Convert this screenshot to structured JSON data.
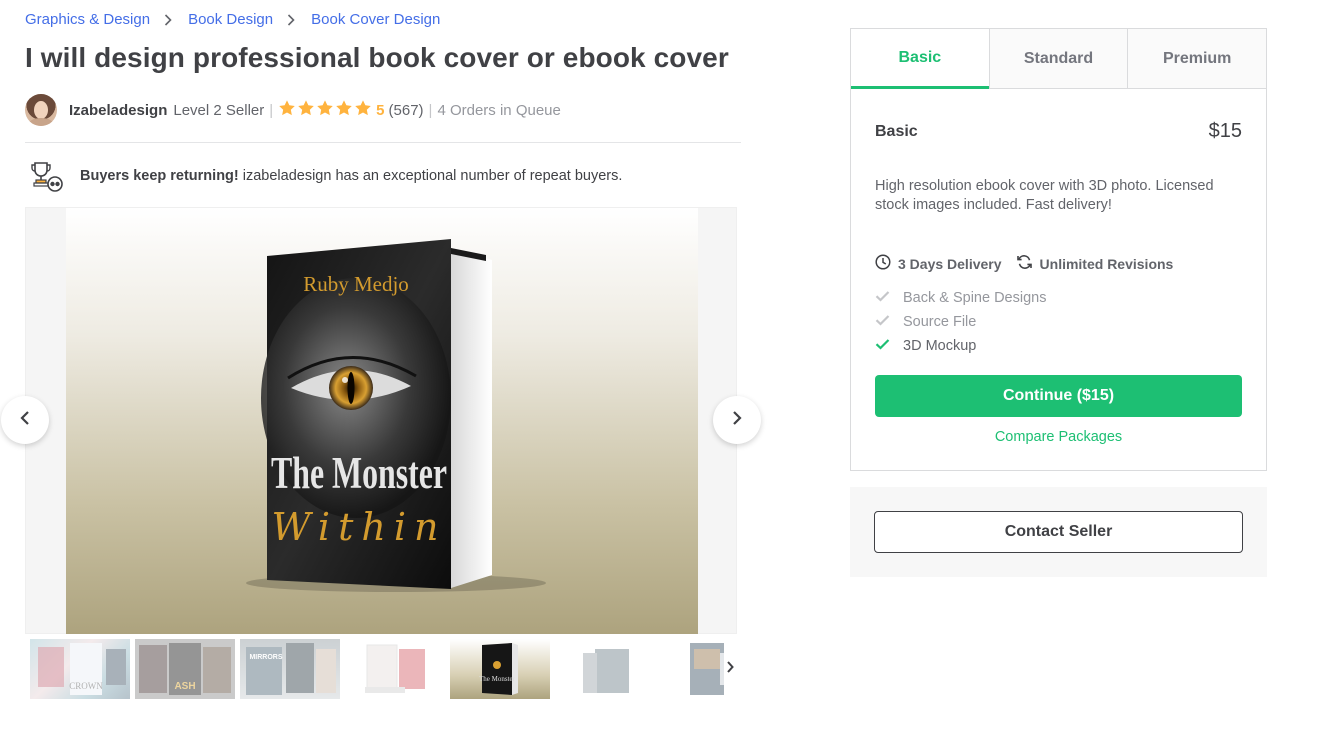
{
  "breadcrumb": {
    "items": [
      "Graphics & Design",
      "Book Design",
      "Book Cover Design"
    ]
  },
  "gig": {
    "title": "I will design professional book cover or ebook cover"
  },
  "seller": {
    "name": "Izabeladesign",
    "level": "Level 2 Seller",
    "rating_value": "5",
    "rating_stars": 5,
    "review_count": "(567)",
    "orders_in_queue": "4 Orders in Queue"
  },
  "repeat_buyers": {
    "headline": "Buyers keep returning!",
    "text": "izabeladesign has an exceptional number of repeat buyers.",
    "icon": "trophy-icon"
  },
  "gallery": {
    "book_author": "Ruby Medjo",
    "book_title_line1": "The Monster",
    "book_title_line2": "Within",
    "active_thumbnail": 5,
    "thumbnail_count": 7
  },
  "packages": {
    "tabs": [
      "Basic",
      "Standard",
      "Premium"
    ],
    "active_tab": "Basic",
    "name": "Basic",
    "price": "$15",
    "description": "High resolution ebook cover with 3D photo. Licensed stock images included. Fast delivery!",
    "delivery": "3 Days Delivery",
    "revisions": "Unlimited Revisions",
    "features": [
      {
        "label": "Back & Spine Designs",
        "included": false
      },
      {
        "label": "Source File",
        "included": false
      },
      {
        "label": "3D Mockup",
        "included": true
      }
    ],
    "continue_label": "Continue ($15)",
    "compare_label": "Compare Packages"
  },
  "contact": {
    "label": "Contact Seller"
  },
  "colors": {
    "accent": "#1dbf73",
    "link": "#446ee7",
    "star": "#ffb33e",
    "text": "#404145"
  }
}
